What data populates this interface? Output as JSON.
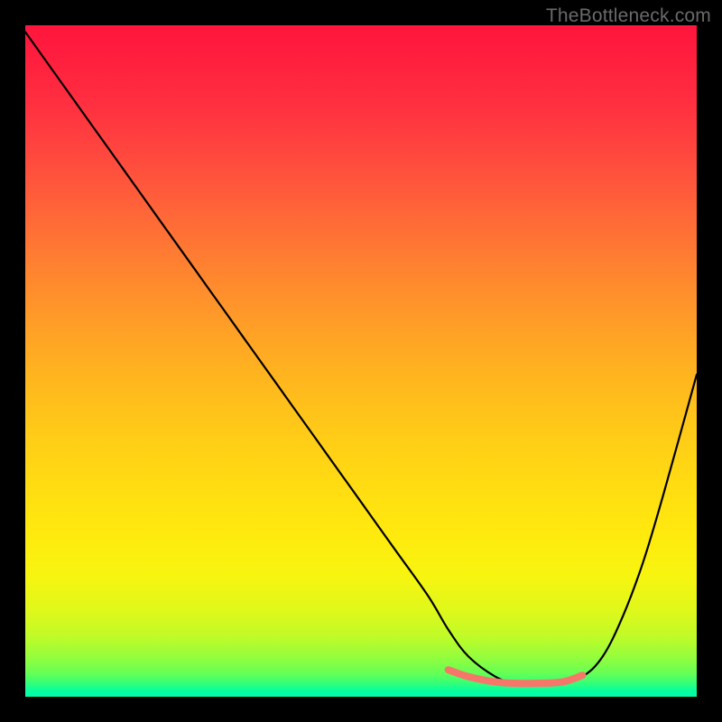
{
  "watermark": "TheBottleneck.com",
  "chart_data": {
    "type": "line",
    "title": "",
    "xlabel": "",
    "ylabel": "",
    "xlim": [
      0,
      100
    ],
    "ylim": [
      0,
      100
    ],
    "grid": false,
    "legend": false,
    "description": "Bottleneck percentage curve: high mismatch (red/top) at left, dipping to minimum (green/bottom) around x≈75, rising again to the right. Color gradient encodes severity from red (high) through yellow to green (low).",
    "series": [
      {
        "name": "main-curve",
        "color": "#000000",
        "x": [
          0,
          5,
          10,
          15,
          20,
          25,
          30,
          35,
          40,
          45,
          50,
          55,
          60,
          63,
          66,
          70,
          73,
          76,
          80,
          83,
          86,
          89,
          92,
          95,
          100
        ],
        "values": [
          99,
          92,
          85,
          78,
          71,
          64,
          57,
          50,
          43,
          36,
          29,
          22,
          15,
          10,
          6,
          3,
          2,
          2,
          2,
          3,
          6,
          12,
          20,
          30,
          48
        ]
      },
      {
        "name": "optimal-band",
        "color": "#f7766a",
        "x": [
          63,
          66,
          70,
          73,
          76,
          80,
          83
        ],
        "values": [
          4.0,
          3.0,
          2.2,
          2.0,
          2.0,
          2.2,
          3.2
        ]
      }
    ]
  }
}
